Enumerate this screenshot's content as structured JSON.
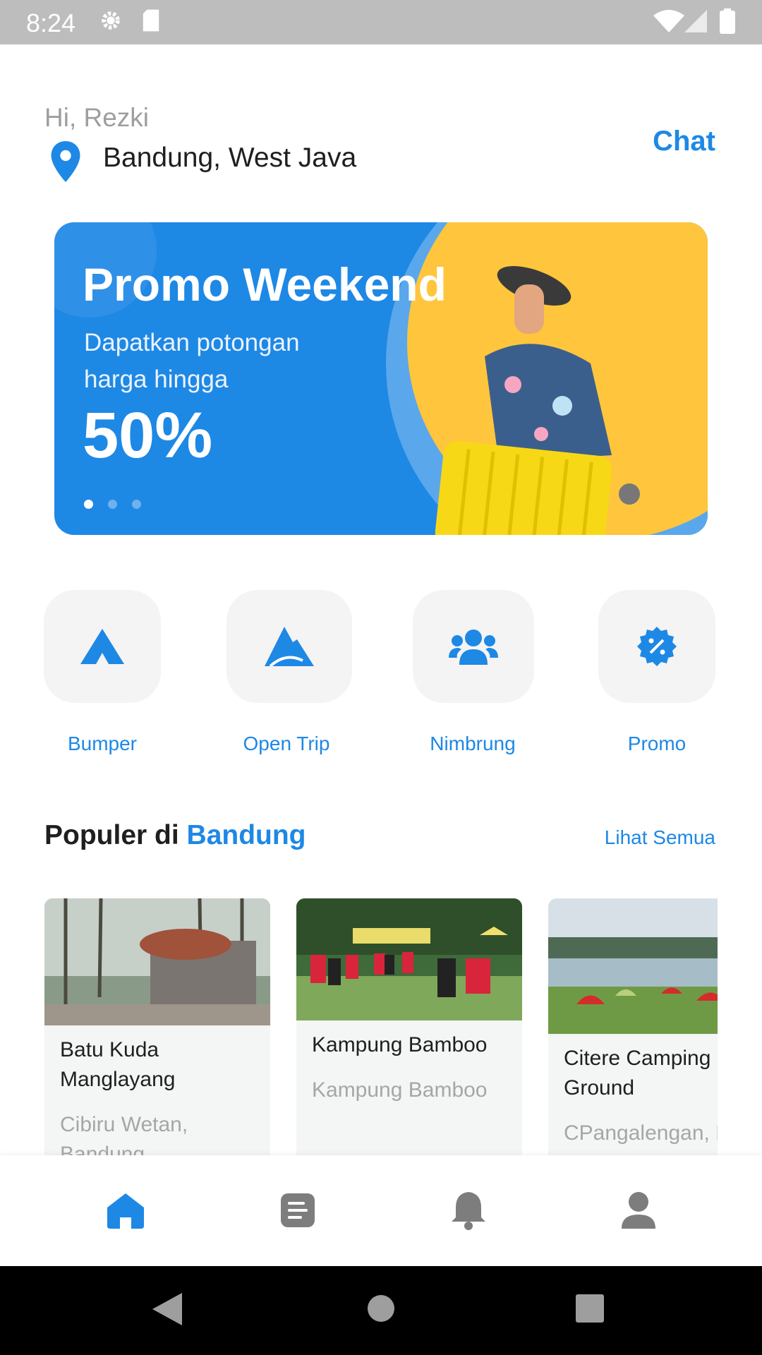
{
  "status_bar": {
    "time": "8:24"
  },
  "header": {
    "greeting": "Hi, Rezki",
    "location": "Bandung, West Java",
    "chat_label": "Chat"
  },
  "banner": {
    "title": "Promo Weekend",
    "subtitle": "Dapatkan potongan harga hingga",
    "highlight": "50%",
    "active_slide": 1,
    "slide_count": 3
  },
  "categories": [
    {
      "label": "Bumper",
      "icon": "tent-icon"
    },
    {
      "label": "Open Trip",
      "icon": "mountain-icon"
    },
    {
      "label": "Nimbrung",
      "icon": "group-icon"
    },
    {
      "label": "Promo",
      "icon": "discount-badge-icon"
    }
  ],
  "popular": {
    "title_prefix": "Populer di",
    "title_city": "Bandung",
    "see_all": "Lihat Semua",
    "places": [
      {
        "name": "Batu Kuda Manglayang",
        "address": "Cibiru Wetan, Bandung"
      },
      {
        "name": "Kampung Bamboo",
        "address": "Kampung Bamboo"
      },
      {
        "name": "Citere Camping Ground",
        "address": "CPangalengan, Bandung"
      }
    ]
  },
  "bottom_nav": [
    {
      "name": "home",
      "icon": "home-icon",
      "active": true
    },
    {
      "name": "orders",
      "icon": "document-icon",
      "active": false
    },
    {
      "name": "notifications",
      "icon": "bell-icon",
      "active": false
    },
    {
      "name": "profile",
      "icon": "user-icon",
      "active": false
    }
  ],
  "colors": {
    "accent": "#1e88e5",
    "banner_yellow": "#ffc53d",
    "tile_bg": "#f4f4f4"
  }
}
